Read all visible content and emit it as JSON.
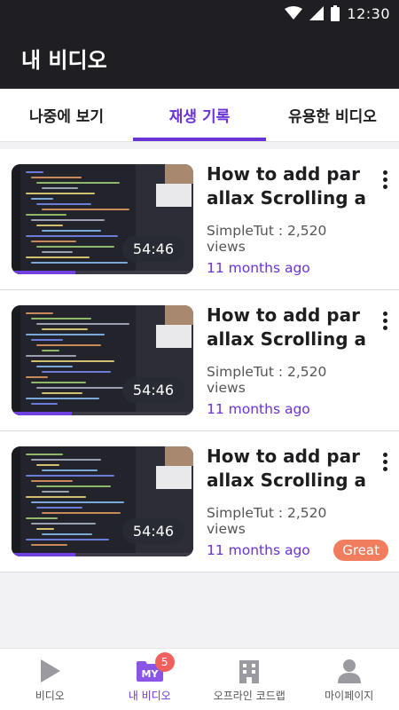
{
  "status": {
    "time": "12:30",
    "icons": [
      "wifi-icon",
      "signal-icon",
      "battery-icon"
    ]
  },
  "header": {
    "title": "내 비디오"
  },
  "tabs": [
    {
      "label": "나중에 보기",
      "active": false
    },
    {
      "label": "재생 기록",
      "active": true
    },
    {
      "label": "유용한 비디오",
      "active": false
    }
  ],
  "videos": [
    {
      "title": "How to add parallax Scrolling and An..",
      "channel": "SimpleTut : 2,520 views",
      "ago": "11 months ago",
      "duration": "54:46",
      "progress": 0.35,
      "badge": ""
    },
    {
      "title": "How to add parallax Scrolling and An..",
      "channel": "SimpleTut : 2,520 views",
      "ago": "11 months ago",
      "duration": "54:46",
      "progress": 0.33,
      "badge": ""
    },
    {
      "title": "How to add parallax Scrolling and An..",
      "channel": "SimpleTut : 2,520 views",
      "ago": "11 months ago",
      "duration": "54:46",
      "progress": 0.35,
      "badge": "Great"
    }
  ],
  "bottom_nav": [
    {
      "label": "비디오",
      "icon": "play-icon",
      "active": false
    },
    {
      "label": "내 비디오",
      "icon": "my-folder-icon",
      "active": true,
      "badge": "5",
      "icon_text": "MY"
    },
    {
      "label": "오프라인 코드랩",
      "icon": "building-icon",
      "active": false
    },
    {
      "label": "마이페이지",
      "icon": "person-icon",
      "active": false
    }
  ],
  "colors": {
    "accent": "#6a33d6",
    "header": "#1e1e23",
    "badge_great": "#f07d5e",
    "nav_badge": "#f0605e"
  }
}
